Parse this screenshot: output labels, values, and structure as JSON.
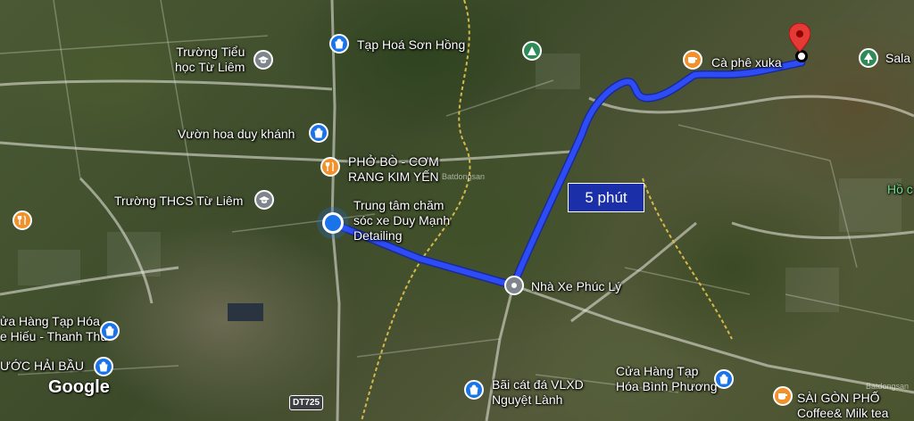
{
  "map": {
    "route_eta": "5 phút",
    "attribution": "Google",
    "road_shield": "DT725",
    "watermark": "Batdongsan",
    "watermark_2": "Batdongsan",
    "route_color": "#2433d8",
    "accent_color": "#1a73e8"
  },
  "places": {
    "tap_hoa_son_hong": "Tạp Hoá Sơn Hồng",
    "truong_tieu_hoc_line1": "Trường Tiểu",
    "truong_tieu_hoc_line2": "học Từ Liêm",
    "vuon_hoa": "Vườn hoa duy khánh",
    "pho_bo_line1": "PHỞ BÒ - CƠM",
    "pho_bo_line2": "RANG KIM YẾN",
    "truong_thcs": "Trường THCS Từ Liêm",
    "trung_tam_line1": "Trung tâm chăm",
    "trung_tam_line2": "sóc xe Duy Mạnh",
    "trung_tam_line3": "Detailing",
    "nha_xe": "Nhà Xe Phúc Lý",
    "ca_phe": "Cà phê xuka",
    "sala": "Sala",
    "ho_c": "Hồ c",
    "cua_hang_left_line1": "ửa Hàng Tạp Hóa",
    "cua_hang_left_line2": "e Hiếu - Thanh Thu",
    "nuoc_hai_bau": "ƯỚC HẢI BẦU",
    "bai_cat_line1": "Bãi cát đá VLXD",
    "bai_cat_line2": "Nguyệt Lành",
    "cua_hang_right_line1": "Cửa Hàng Tạp",
    "cua_hang_right_line2": "Hóa Bình Phương",
    "saigon_pho_line1": "SÀI GÒN PHỐ",
    "saigon_pho_line2": "Coffee& Milk tea"
  },
  "icons": {
    "shopping": "shopping-bag-icon",
    "school": "school-icon",
    "restaurant": "restaurant-icon",
    "cafe": "coffee-icon",
    "park": "tree-icon",
    "camp": "campground-icon",
    "generic": "pin-icon",
    "destination": "red-pin-icon"
  }
}
